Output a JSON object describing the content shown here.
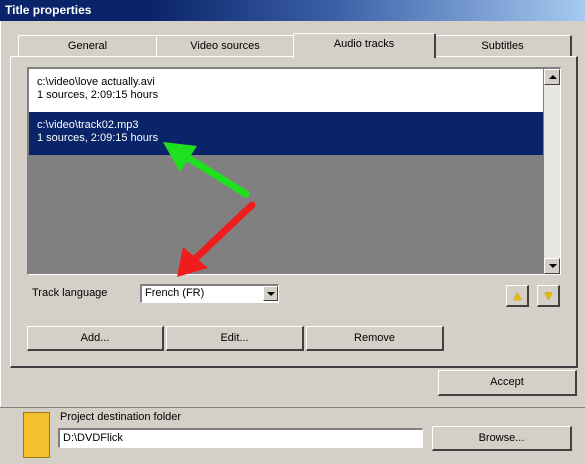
{
  "window": {
    "title": "Title properties"
  },
  "tabs": [
    {
      "label": "General"
    },
    {
      "label": "Video sources"
    },
    {
      "label": "Audio tracks"
    },
    {
      "label": "Subtitles"
    }
  ],
  "active_tab": "Audio tracks",
  "audio_tracks": [
    {
      "path": "c:\\video\\love actually.avi",
      "info": "1 sources, 2:09:15 hours",
      "selected": false
    },
    {
      "path": "c:\\video\\track02.mp3",
      "info": "1 sources, 2:09:15 hours",
      "selected": true
    }
  ],
  "track_language": {
    "label": "Track language",
    "value": "French (FR)"
  },
  "buttons": {
    "add": "Add...",
    "edit": "Edit...",
    "remove": "Remove",
    "accept": "Accept",
    "browse": "Browse..."
  },
  "icons": {
    "move_up": "arrow-up-icon",
    "move_down": "arrow-down-icon",
    "folder": "folder-icon"
  },
  "destination": {
    "label": "Project destination folder",
    "value": "D:\\DVDFlick"
  },
  "annotations": {
    "green_arrow_color": "#1fe01f",
    "red_arrow_color": "#ee1c1c"
  },
  "colors": {
    "selection": "#0a246a",
    "dialog": "#d4d0c8"
  }
}
